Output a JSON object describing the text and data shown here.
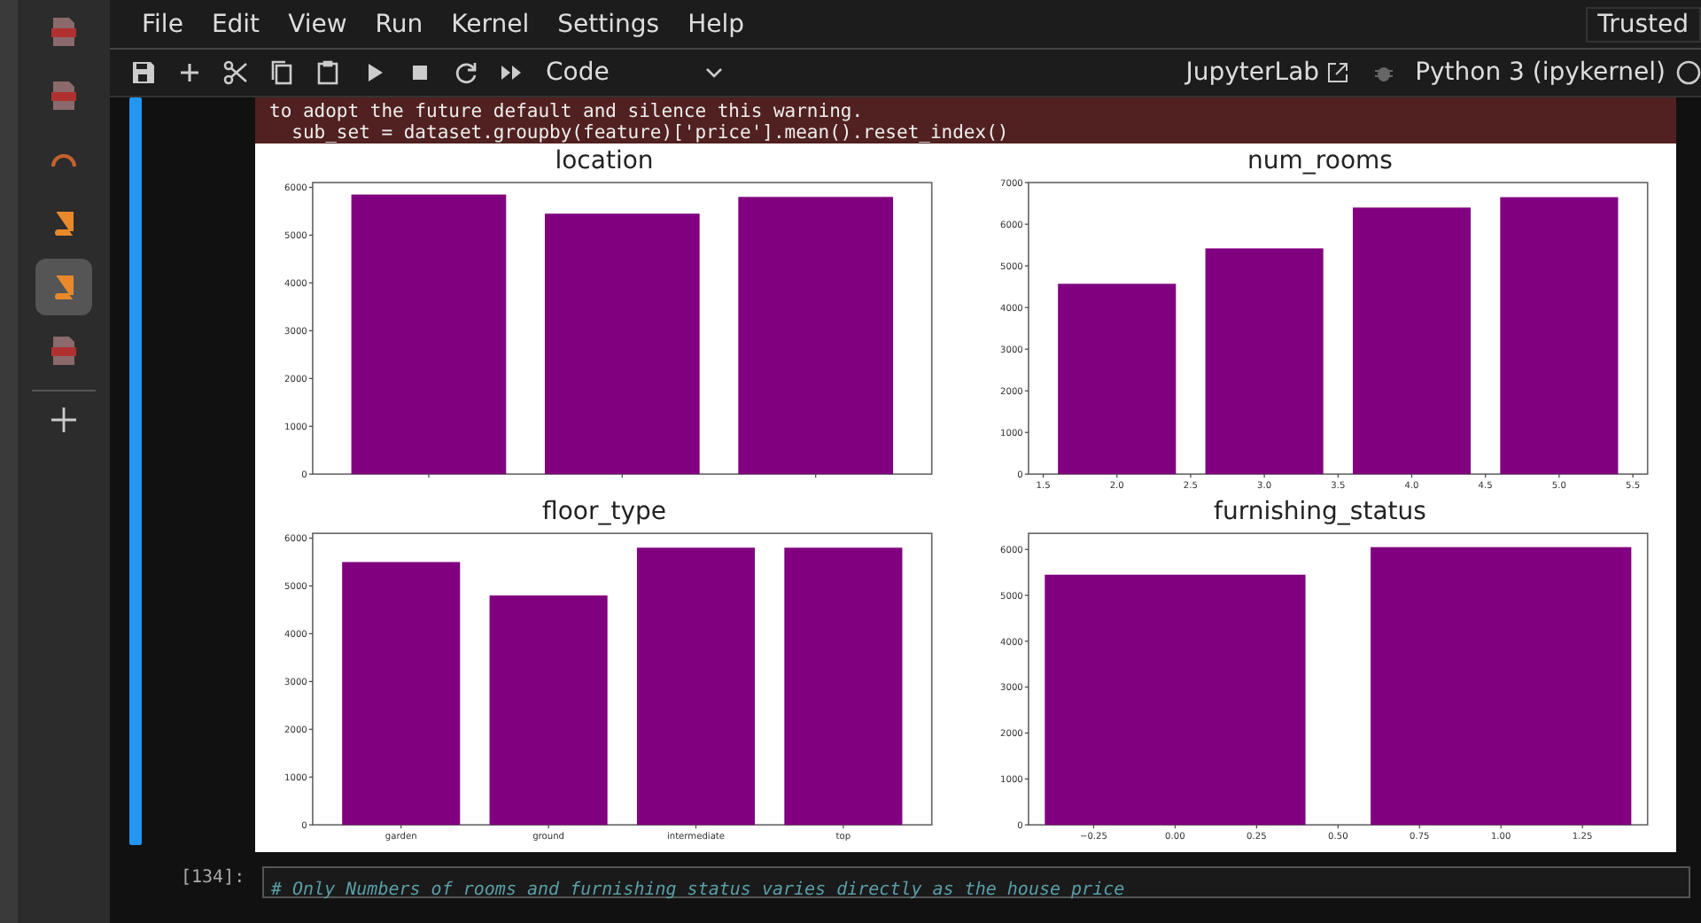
{
  "sidebar": {
    "items": [
      {
        "kind": "pdf",
        "selected": false
      },
      {
        "kind": "pdf",
        "selected": false
      },
      {
        "kind": "arc",
        "selected": false
      },
      {
        "kind": "book",
        "selected": false
      },
      {
        "kind": "book",
        "selected": true
      },
      {
        "kind": "pdf",
        "selected": false
      },
      {
        "kind": "plus",
        "selected": false
      }
    ]
  },
  "menu": [
    "File",
    "Edit",
    "View",
    "Run",
    "Kernel",
    "Settings",
    "Help"
  ],
  "trusted": "Trusted",
  "toolbar": {
    "tools": [
      {
        "kind": "save"
      },
      {
        "kind": "add"
      },
      {
        "kind": "cut"
      },
      {
        "kind": "copy"
      },
      {
        "kind": "paste"
      },
      {
        "kind": "run"
      },
      {
        "kind": "stop"
      },
      {
        "kind": "restart"
      },
      {
        "kind": "run-all"
      }
    ],
    "cell_type": "Code",
    "jupyterlab": "JupyterLab",
    "kernel": "Python 3 (ipykernel)"
  },
  "warning": [
    "to adopt the future default and silence this warning.",
    "  sub_set = dataset.groupby(feature)['price'].mean().reset_index()"
  ],
  "charts": [
    {
      "chart_data": {
        "type": "bar",
        "title": "location",
        "categories": [
          null,
          null,
          null
        ],
        "series": [
          {
            "color": "#800080",
            "values": [
              5850,
              5450,
              5800
            ]
          }
        ],
        "ylim": [
          0,
          6100
        ],
        "yticks": [
          0,
          1000,
          2000,
          3000,
          4000,
          5000,
          6000
        ]
      }
    },
    {
      "chart_data": {
        "type": "bar",
        "title": "num_rooms",
        "x": [
          2,
          3,
          4,
          5
        ],
        "xlim": [
          1.4,
          5.6
        ],
        "xticks": [
          1.5,
          {
            "value": 2,
            "label": "2.0"
          },
          2.5,
          {
            "value": 3,
            "label": "3.0"
          },
          3.5,
          {
            "value": 4,
            "label": "4.0"
          },
          4.5,
          {
            "value": 5,
            "label": "5.0"
          },
          5.5
        ],
        "series": [
          {
            "color": "#800080",
            "values": [
              4570,
              5420,
              6400,
              6650
            ]
          }
        ],
        "ylim": [
          0,
          7000
        ],
        "yticks": [
          0,
          1000,
          2000,
          3000,
          4000,
          5000,
          6000,
          7000
        ]
      }
    },
    {
      "chart_data": {
        "type": "bar",
        "title": "floor_type",
        "categories": [
          "garden",
          "ground",
          "intermediate",
          "top"
        ],
        "series": [
          {
            "color": "#800080",
            "values": [
              5500,
              4800,
              5800,
              5800
            ]
          }
        ],
        "ylim": [
          0,
          6100
        ],
        "yticks": [
          0,
          1000,
          2000,
          3000,
          4000,
          5000,
          6000
        ]
      }
    },
    {
      "chart_data": {
        "type": "bar",
        "title": "furnishing_status",
        "x": [
          0,
          1
        ],
        "xlim": [
          -0.45,
          1.45
        ],
        "xticks": [
          {
            "value": -0.25,
            "label": "−0.25"
          },
          {
            "value": 0,
            "label": "0.00"
          },
          0.25,
          {
            "value": 0.5,
            "label": "0.50"
          },
          0.75,
          {
            "value": 1,
            "label": "1.00"
          },
          1.25
        ],
        "series": [
          {
            "color": "#800080",
            "values": [
              5450,
              6050
            ]
          }
        ],
        "ylim": [
          0,
          6350
        ],
        "yticks": [
          0,
          1000,
          2000,
          3000,
          4000,
          5000,
          6000
        ]
      }
    }
  ],
  "next_cell": {
    "prompt": "[134]:",
    "code": "# Only Numbers of rooms and furnishing status varies directly as the house price"
  }
}
